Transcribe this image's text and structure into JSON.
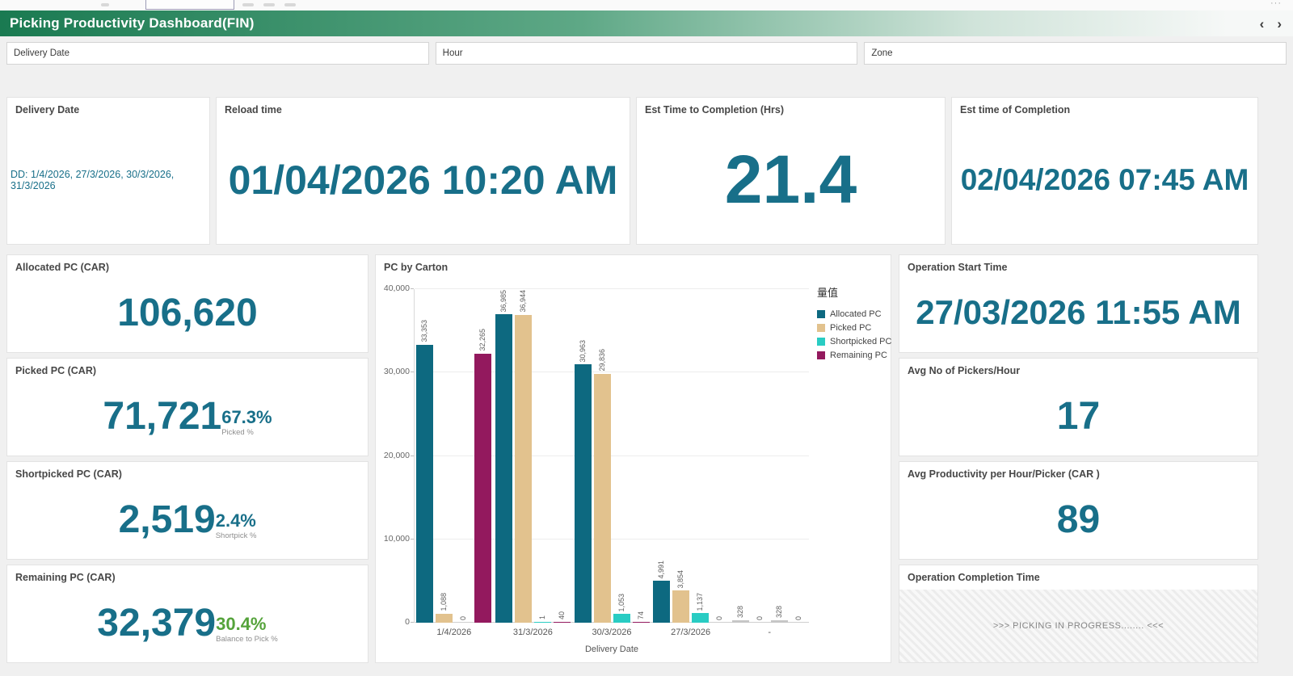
{
  "chrome": {
    "overflow_dots": "···"
  },
  "header": {
    "title": "Picking Productivity Dashboard(FIN)",
    "nav_prev": "‹",
    "nav_next": "›"
  },
  "filters": [
    {
      "label": "Delivery Date"
    },
    {
      "label": "Hour"
    },
    {
      "label": "Zone"
    }
  ],
  "colors": {
    "header_green": "#1a7a51",
    "kpi_teal": "#186f89",
    "pct_green": "#55a33b",
    "muted_bar": "#c6c6c6"
  },
  "kpis": {
    "delivery_date": {
      "title": "Delivery Date",
      "value": "DD: 1/4/2026, 27/3/2026, 30/3/2026, 31/3/2026"
    },
    "reload_time": {
      "title": "Reload time",
      "value": "01/04/2026 10:20 AM"
    },
    "est_time_to_completion": {
      "title": "Est Time to Completion (Hrs)",
      "value": "21.4"
    },
    "est_time_of_completion": {
      "title": "Est time of Completion",
      "value": "02/04/2026 07:45 AM"
    },
    "allocated": {
      "title": "Allocated PC (CAR)",
      "value": "106,620"
    },
    "picked": {
      "title": "Picked PC (CAR)",
      "value": "71,721",
      "pct": "67.3%",
      "pct_label": "Picked %"
    },
    "shortpicked": {
      "title": "Shortpicked PC (CAR)",
      "value": "2,519",
      "pct": "2.4%",
      "pct_label": "Shortpick %"
    },
    "remaining": {
      "title": "Remaining PC (CAR)",
      "value": "32,379",
      "pct": "30.4%",
      "pct_label": "Balance to Pick %"
    },
    "operation_start": {
      "title": "Operation Start Time",
      "value": "27/03/2026 11:55 AM"
    },
    "pickers_per_hour": {
      "title": "Avg No of Pickers/Hour",
      "value": "17"
    },
    "productivity": {
      "title": "Avg Productivity per Hour/Picker (CAR )",
      "value": "89"
    },
    "operation_completion": {
      "title": "Operation Completion Time",
      "status": ">>> PICKING IN PROGRESS........ <<<"
    }
  },
  "chart_data": {
    "type": "bar",
    "title": "PC by Carton",
    "xlabel": "Delivery Date",
    "ylabel": "",
    "legend_title": "量值",
    "legend_position": "right",
    "grid": true,
    "ylim": [
      0,
      40000
    ],
    "yticks": [
      {
        "value": 0,
        "label": "0"
      },
      {
        "value": 10000,
        "label": "10,000"
      },
      {
        "value": 20000,
        "label": "20,000"
      },
      {
        "value": 30000,
        "label": "30,000"
      },
      {
        "value": 40000,
        "label": "40,000"
      }
    ],
    "categories": [
      "1/4/2026",
      "31/3/2026",
      "30/3/2026",
      "27/3/2026",
      "-"
    ],
    "series": [
      {
        "name": "Allocated PC",
        "color": "#0d6980",
        "values": [
          33353,
          36985,
          30963,
          4991,
          328
        ]
      },
      {
        "name": "Picked PC",
        "color": "#e2c28e",
        "values": [
          1088,
          36944,
          29836,
          3854,
          0
        ]
      },
      {
        "name": "Shortpicked PC",
        "color": "#29ccc3",
        "values": [
          0,
          1,
          1053,
          1137,
          328
        ]
      },
      {
        "name": "Remaining PC",
        "color": "#93195e",
        "values": [
          32265,
          40,
          74,
          0,
          0
        ]
      }
    ],
    "muted_category": "-",
    "muted_color": "#c6c6c6"
  }
}
